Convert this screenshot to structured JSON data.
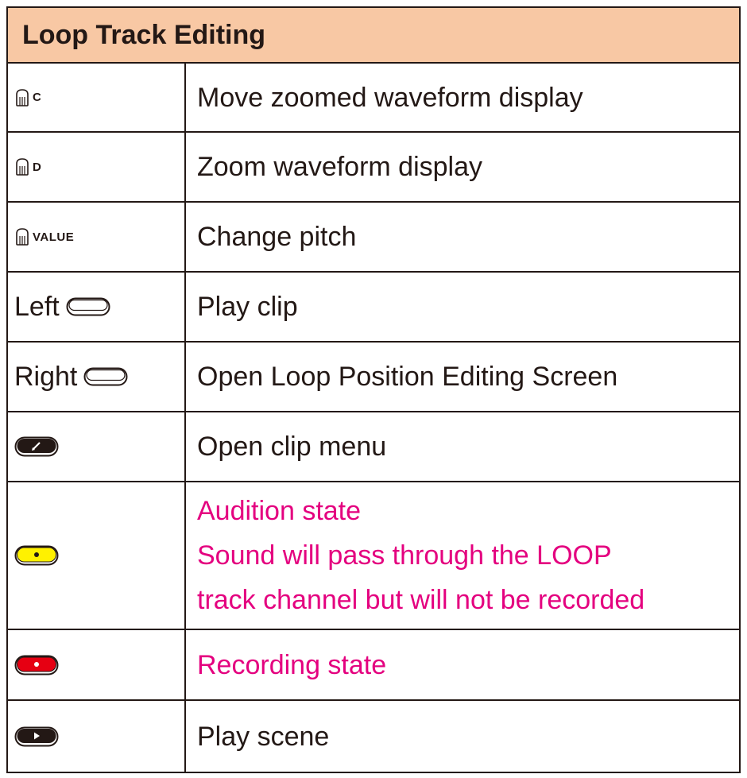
{
  "title": "Loop Track Editing",
  "colors": {
    "header_bg": "#f8c8a4",
    "border": "#231815",
    "highlight_text": "#e4007f",
    "yellow_button": "#fff100",
    "red_button": "#e60012"
  },
  "rows": [
    {
      "control": {
        "icon": "knob-icon",
        "suffix": "C"
      },
      "action": [
        "Move zoomed waveform display"
      ]
    },
    {
      "control": {
        "icon": "knob-icon",
        "suffix": "D"
      },
      "action": [
        "Zoom waveform display"
      ]
    },
    {
      "control": {
        "icon": "knob-icon",
        "suffix": "VALUE"
      },
      "action": [
        "Change pitch"
      ]
    },
    {
      "control": {
        "icon": "blank-button-icon",
        "label": "Left"
      },
      "action": [
        "Play clip"
      ]
    },
    {
      "control": {
        "icon": "blank-button-icon",
        "label": "Right"
      },
      "action": [
        "Open Loop Position Editing Screen"
      ]
    },
    {
      "control": {
        "icon": "edit-button-icon"
      },
      "action": [
        "Open clip menu"
      ]
    },
    {
      "control": {
        "icon": "yellow-record-button-icon"
      },
      "action": [
        "Audition state",
        "Sound will pass through the LOOP",
        "track channel but will not be recorded"
      ]
    },
    {
      "control": {
        "icon": "red-record-button-icon"
      },
      "action": [
        "Recording state"
      ]
    },
    {
      "control": {
        "icon": "play-button-icon"
      },
      "action": [
        "Play scene"
      ]
    }
  ]
}
